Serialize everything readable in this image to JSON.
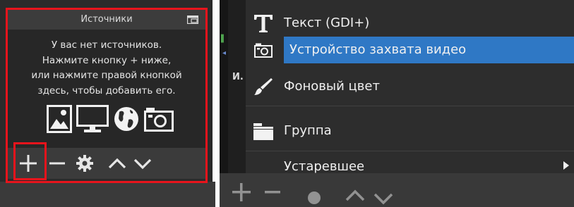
{
  "left_panel": {
    "title": "Источники",
    "empty_message": [
      "У вас нет источников.",
      "Нажмите кнопку + ниже,",
      "или нажмите правой кнопкой",
      "здесь, чтобы добавить его."
    ],
    "empty_icons": [
      "image-icon",
      "monitor-icon",
      "globe-icon",
      "camera-icon"
    ],
    "toolbar": [
      "add-icon",
      "remove-icon",
      "settings-icon",
      "move-up-icon",
      "move-down-icon"
    ]
  },
  "right_panel": {
    "side_label": "И.",
    "menu": [
      {
        "label": "Текст (GDI+)",
        "icon": "text-icon",
        "selected": false
      },
      {
        "label": "Устройство захвата видео",
        "icon": "camera-icon",
        "selected": true
      },
      {
        "label": "Фоновый цвет",
        "icon": "brush-icon",
        "selected": false
      },
      {
        "label": "Группа",
        "icon": "folder-icon",
        "selected": false
      },
      {
        "label": "Устаревшее",
        "icon": "",
        "selected": false,
        "submenu": true
      }
    ]
  },
  "colors": {
    "highlight_frame": "#e8141c",
    "menu_selected": "#2f78c5",
    "panel_bg": "#2b2b2b"
  }
}
